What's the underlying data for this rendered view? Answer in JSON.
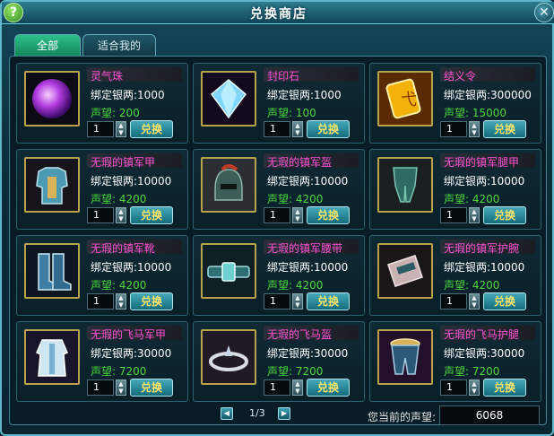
{
  "window": {
    "title": "兑换商店"
  },
  "tabs": [
    {
      "label": "全部",
      "active": true
    },
    {
      "label": "适合我的",
      "active": false
    }
  ],
  "items": [
    {
      "name": "灵气珠",
      "price_label": "绑定银两:1000",
      "rep_label": "声望: 200",
      "qty": "1",
      "button": "兑换",
      "icon": "purple-orb-icon"
    },
    {
      "name": "封印石",
      "price_label": "绑定银两:1000",
      "rep_label": "声望: 100",
      "qty": "1",
      "button": "兑换",
      "icon": "diamond-gem-icon"
    },
    {
      "name": "结义令",
      "price_label": "绑定银两:300000",
      "rep_label": "声望: 15000",
      "qty": "1",
      "button": "兑换",
      "icon": "gold-token-icon"
    },
    {
      "name": "无瑕的镇军甲",
      "price_label": "绑定银两:10000",
      "rep_label": "声望: 4200",
      "qty": "1",
      "button": "兑换",
      "icon": "armor-icon"
    },
    {
      "name": "无瑕的镇军盔",
      "price_label": "绑定银两:10000",
      "rep_label": "声望: 4200",
      "qty": "1",
      "button": "兑换",
      "icon": "helmet-icon"
    },
    {
      "name": "无瑕的镇军腿甲",
      "price_label": "绑定银两:10000",
      "rep_label": "声望: 4200",
      "qty": "1",
      "button": "兑换",
      "icon": "leg-armor-icon"
    },
    {
      "name": "无瑕的镇军靴",
      "price_label": "绑定银两:10000",
      "rep_label": "声望: 4200",
      "qty": "1",
      "button": "兑换",
      "icon": "boots-icon"
    },
    {
      "name": "无瑕的镇军腰带",
      "price_label": "绑定银两:10000",
      "rep_label": "声望: 4200",
      "qty": "1",
      "button": "兑换",
      "icon": "belt-icon"
    },
    {
      "name": "无瑕的镇军护腕",
      "price_label": "绑定银两:10000",
      "rep_label": "声望: 4200",
      "qty": "1",
      "button": "兑换",
      "icon": "bracer-icon"
    },
    {
      "name": "无瑕的飞马军甲",
      "price_label": "绑定银两:30000",
      "rep_label": "声望: 7200",
      "qty": "1",
      "button": "兑换",
      "icon": "robe-icon"
    },
    {
      "name": "无瑕的飞马盔",
      "price_label": "绑定银两:30000",
      "rep_label": "声望: 7200",
      "qty": "1",
      "button": "兑换",
      "icon": "circlet-icon"
    },
    {
      "name": "无瑕的飞马护腿",
      "price_label": "绑定银两:30000",
      "rep_label": "声望: 7200",
      "qty": "1",
      "button": "兑换",
      "icon": "greaves-icon"
    }
  ],
  "pager": {
    "page": "1/3"
  },
  "reputation": {
    "label": "您当前的声望:",
    "value": "6068"
  },
  "colors": {
    "item_name": "#ff52d3",
    "reputation_value": "#4cd63c",
    "button_text": "#ffe76b",
    "active_tab": "#1fa06e"
  }
}
